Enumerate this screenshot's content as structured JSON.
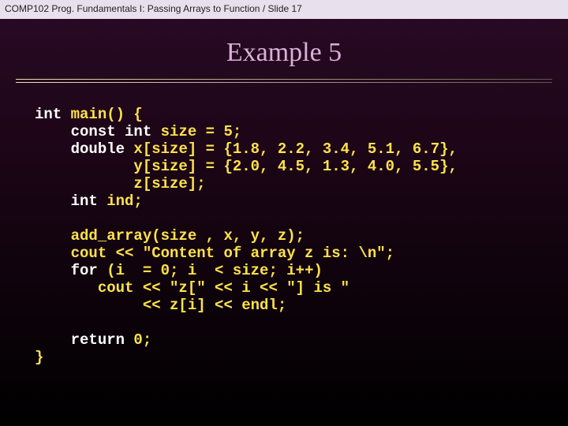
{
  "header": "COMP102  Prog. Fundamentals I: Passing Arrays to Function / Slide 17",
  "title": "Example 5",
  "code": {
    "l01a": "int",
    "l01b": " main() {",
    "l02a": "    const int",
    "l02b": " size = 5;",
    "l03a": "    double",
    "l03b": " x[size] = {1.8, 2.2, 3.4, 5.1, 6.7},",
    "l04": "           y[size] = {2.0, 4.5, 1.3, 4.0, 5.5},",
    "l05": "           z[size];",
    "l06a": "    int",
    "l06b": " ind;",
    "l08": "    add_array(size , x, y, z);",
    "l09": "    cout << \"Content of array z is: \\n\";",
    "l10a": "    for",
    "l10b": " (i  = 0; i  < size; i++)",
    "l11": "       cout << \"z[\" << i << \"] is \"",
    "l12": "            << z[i] << endl;",
    "l14a": "    return",
    "l14b": " 0;",
    "l15": "}"
  }
}
